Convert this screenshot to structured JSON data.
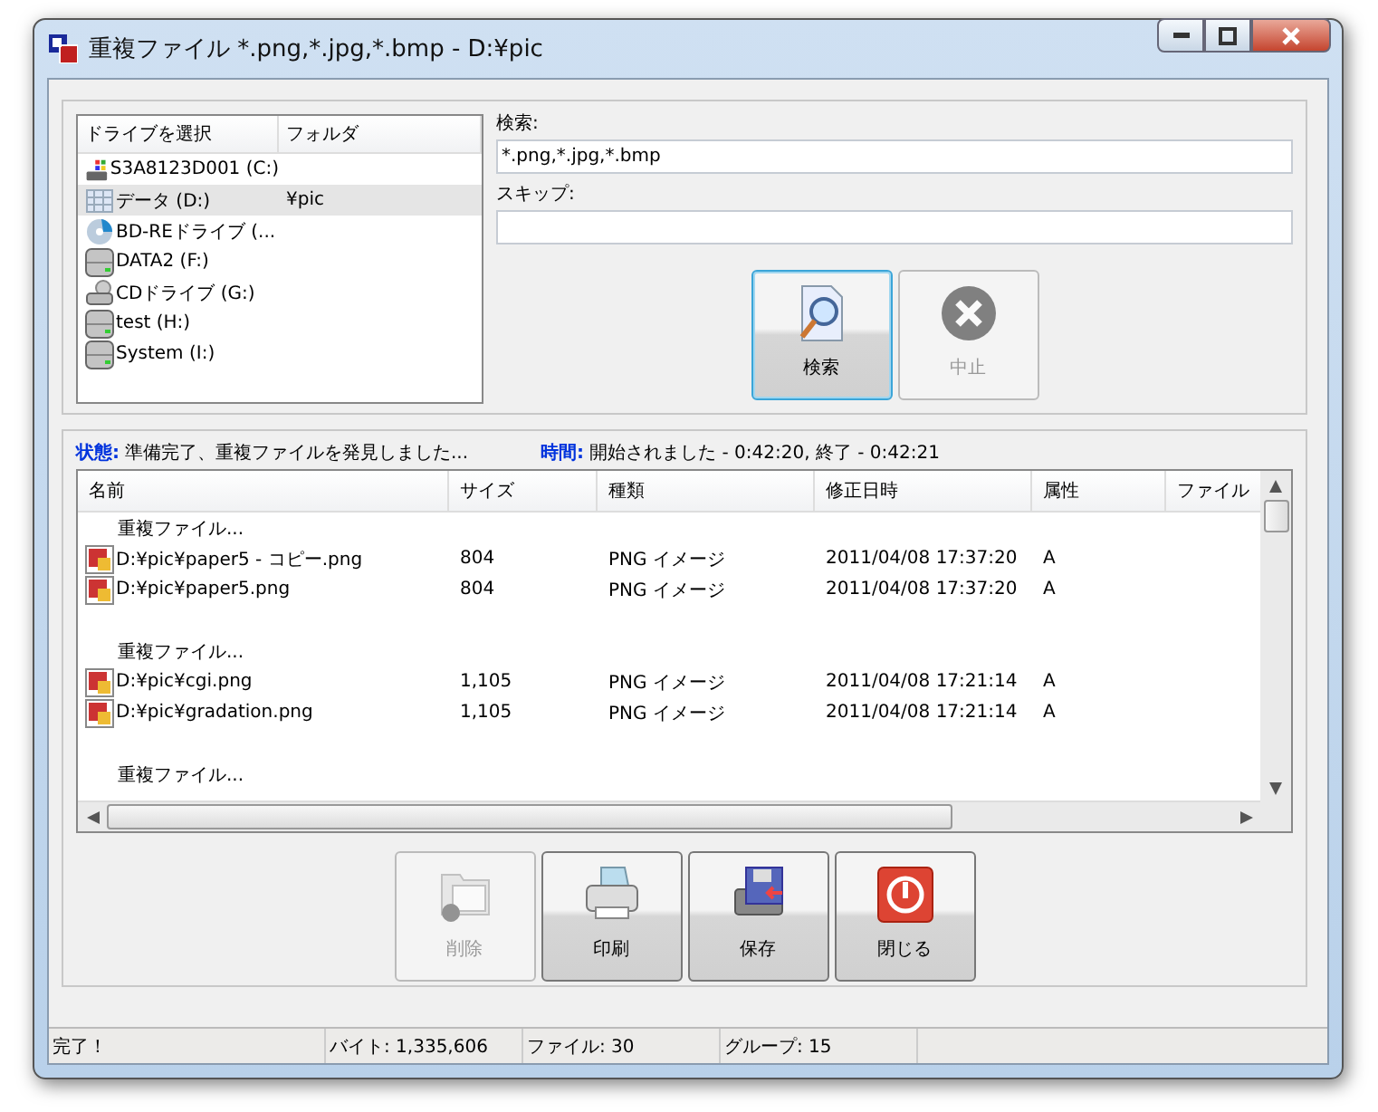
{
  "window": {
    "title": "重複ファイル *.png,*.jpg,*.bmp - D:¥pic"
  },
  "drives": {
    "columns": [
      "ドライブを選択",
      "フォルダ"
    ],
    "items": [
      {
        "kind": "system",
        "name": "S3A8123D001 (C:)",
        "selected": false
      },
      {
        "kind": "data",
        "name": "データ (D:)",
        "folder": "¥pic",
        "selected": true
      },
      {
        "kind": "disc",
        "name": "BD-REドライブ (...",
        "selected": false
      },
      {
        "kind": "hdd",
        "name": "DATA2 (F:)",
        "selected": false
      },
      {
        "kind": "cd",
        "name": "CDドライブ (G:)",
        "selected": false
      },
      {
        "kind": "hdd",
        "name": "test (H:)",
        "selected": false
      },
      {
        "kind": "hdd",
        "name": "System (I:)",
        "selected": false
      }
    ]
  },
  "search": {
    "label": "検索:",
    "value": "*.png,*.jpg,*.bmp"
  },
  "skip": {
    "label": "スキップ:"
  },
  "search_buttons": [
    {
      "kind": "search",
      "label": "検索",
      "disabled": false,
      "focused": true
    },
    {
      "kind": "stop",
      "label": "中止",
      "disabled": true,
      "focused": false
    }
  ],
  "status_line": {
    "status_label": "状態:",
    "status": "準備完了、重複ファイルを発見しました...",
    "time_label": "時間:",
    "time": "開始されました - 0:42:20, 終了 - 0:42:21"
  },
  "results": {
    "columns": [
      "名前",
      "サイズ",
      "種類",
      "修正日時",
      "属性",
      "ファイル"
    ],
    "rows": [
      {
        "kind": "group",
        "name": "重複ファイル..."
      },
      {
        "kind": "file",
        "name": "D:¥pic¥paper5 - コピー.png",
        "size": "804",
        "type": "PNG イメージ",
        "modified": "2011/04/08 17:37:20",
        "attr": "A"
      },
      {
        "kind": "file",
        "name": "D:¥pic¥paper5.png",
        "size": "804",
        "type": "PNG イメージ",
        "modified": "2011/04/08 17:37:20",
        "attr": "A"
      },
      {
        "kind": "blank"
      },
      {
        "kind": "group",
        "name": "重複ファイル..."
      },
      {
        "kind": "file",
        "name": "D:¥pic¥cgi.png",
        "size": "1,105",
        "type": "PNG イメージ",
        "modified": "2011/04/08 17:21:14",
        "attr": "A"
      },
      {
        "kind": "file",
        "name": "D:¥pic¥gradation.png",
        "size": "1,105",
        "type": "PNG イメージ",
        "modified": "2011/04/08 17:21:14",
        "attr": "A"
      },
      {
        "kind": "blank"
      },
      {
        "kind": "group",
        "name": "重複ファイル..."
      }
    ]
  },
  "action_buttons": [
    {
      "kind": "delete",
      "label": "削除",
      "disabled": true
    },
    {
      "kind": "print",
      "label": "印刷",
      "disabled": false
    },
    {
      "kind": "save",
      "label": "保存",
      "disabled": false
    },
    {
      "kind": "close",
      "label": "閉じる",
      "disabled": false
    }
  ],
  "status_bar": [
    "完了！",
    "バイト: 1,335,606",
    "ファイル: 30",
    "グループ: 15"
  ]
}
